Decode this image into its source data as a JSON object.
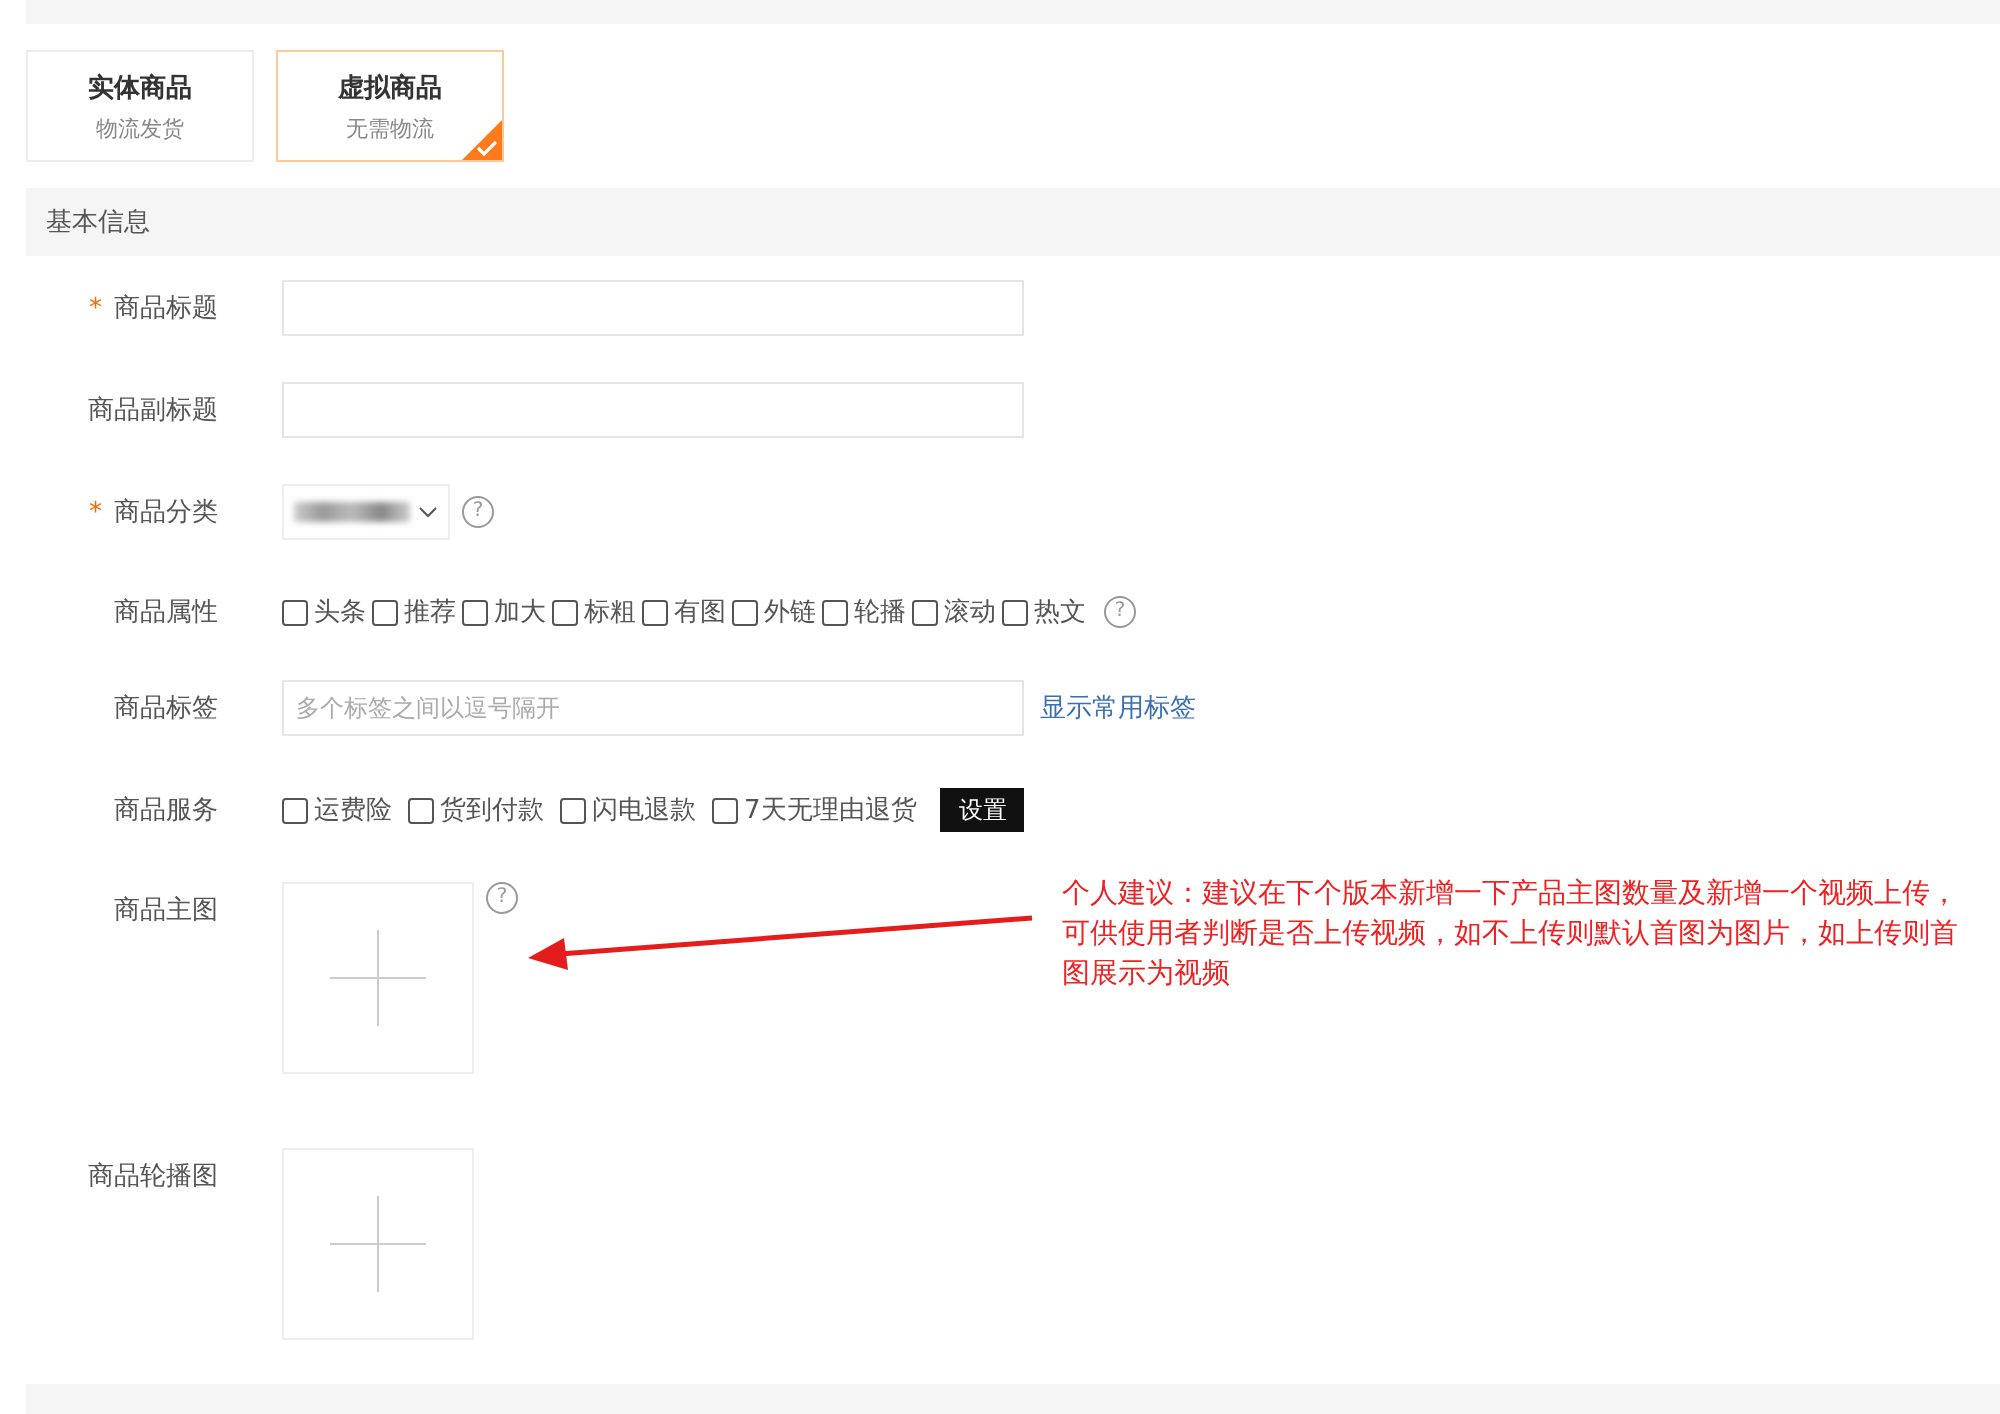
{
  "product_types": [
    {
      "title": "实体商品",
      "subtitle": "物流发货",
      "selected": false
    },
    {
      "title": "虚拟商品",
      "subtitle": "无需物流",
      "selected": true
    }
  ],
  "basic_info": {
    "title": "基本信息",
    "fields": [
      {
        "kind": "text",
        "label": "商品标题",
        "required_mark": "*"
      },
      {
        "kind": "text",
        "label": "商品副标题"
      },
      {
        "kind": "select",
        "label": "商品分类",
        "required_mark": "*",
        "help": "?"
      },
      {
        "kind": "checks",
        "label": "商品属性",
        "help": "?",
        "options": [
          {
            "label": "头条",
            "checked": false
          },
          {
            "label": "推荐",
            "checked": false
          },
          {
            "label": "加大",
            "checked": false
          },
          {
            "label": "标粗",
            "checked": false
          },
          {
            "label": "有图",
            "checked": false
          },
          {
            "label": "外链",
            "checked": false
          },
          {
            "label": "轮播",
            "checked": false
          },
          {
            "label": "滚动",
            "checked": false
          },
          {
            "label": "热文",
            "checked": false
          }
        ]
      },
      {
        "kind": "tags",
        "label": "商品标签",
        "placeholder": "多个标签之间以逗号隔开",
        "link": "显示常用标签"
      },
      {
        "kind": "services",
        "label": "商品服务",
        "options": [
          {
            "label": "运费险",
            "checked": false
          },
          {
            "label": "货到付款",
            "checked": false
          },
          {
            "label": "闪电退款",
            "checked": false
          },
          {
            "label": "7天无理由退货",
            "checked": false
          }
        ],
        "button": "设置"
      },
      {
        "kind": "upload",
        "label": "商品主图",
        "help": "?"
      },
      {
        "kind": "upload",
        "label": "商品轮播图"
      }
    ]
  },
  "annotation": {
    "text": "个人建议：建议在下个版本新增一下产品主图数量及新增一个视频上传，可供使用者判断是否上传视频，如不上传则默认首图为图片，如上传则首图展示为视频"
  }
}
